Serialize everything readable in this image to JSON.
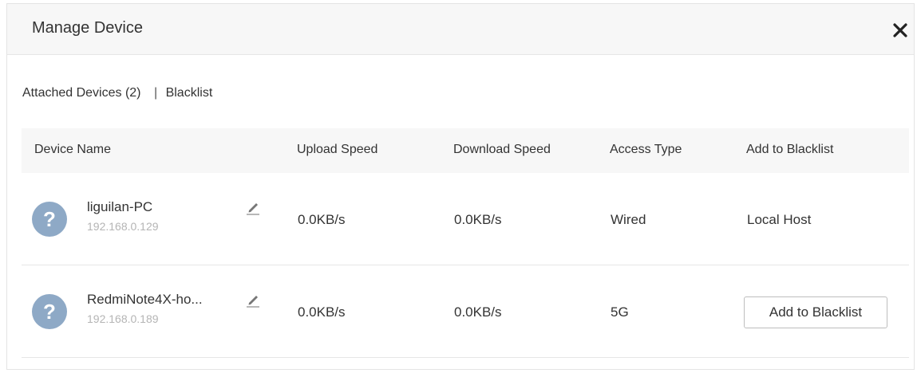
{
  "dialog": {
    "title": "Manage Device",
    "close_icon": "close-icon"
  },
  "tabs": {
    "attached": "Attached Devices (2)",
    "separator": "|",
    "blacklist": "Blacklist"
  },
  "table": {
    "headers": {
      "device_name": "Device Name",
      "upload": "Upload Speed",
      "download": "Download Speed",
      "access": "Access Type",
      "blacklist": "Add to Blacklist"
    },
    "rows": [
      {
        "avatar": "?",
        "name": "liguilan-PC",
        "ip": "192.168.0.129",
        "upload": "0.0KB/s",
        "download": "0.0KB/s",
        "access": "Wired",
        "blacklist_text": "Local Host"
      },
      {
        "avatar": "?",
        "name": "RedmiNote4X-ho...",
        "ip": "192.168.0.189",
        "upload": "0.0KB/s",
        "download": "0.0KB/s",
        "access": "5G",
        "blacklist_button": "Add to Blacklist"
      }
    ]
  },
  "colors": {
    "header_bg": "#f7f7f7",
    "avatar_bg": "#8ea9c6",
    "ip_text": "#b5b5b5",
    "border": "#e6e6e6"
  },
  "icons": {
    "edit": "pencil-icon",
    "unknown_device": "question-mark-icon"
  }
}
